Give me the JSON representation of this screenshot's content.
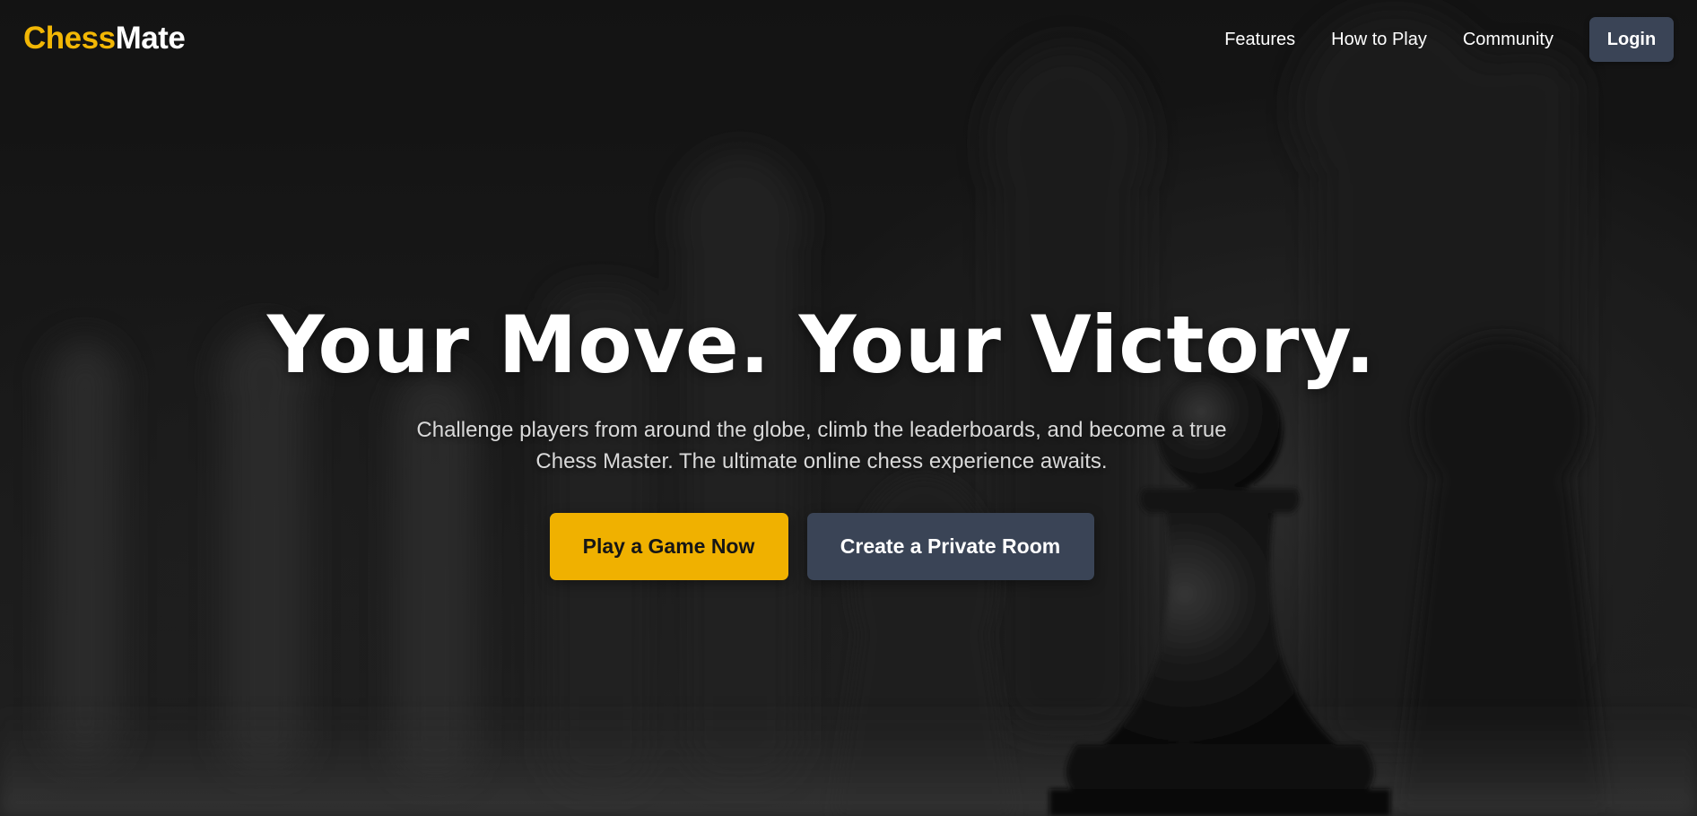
{
  "brand": {
    "part1": "Chess",
    "part2": "Mate",
    "accent_color": "#f2b705"
  },
  "nav": {
    "links": [
      {
        "label": "Features"
      },
      {
        "label": "How to Play"
      },
      {
        "label": "Community"
      }
    ],
    "login_label": "Login"
  },
  "hero": {
    "title": "Your Move. Your Victory.",
    "subtitle": "Challenge players from around the globe, climb the leaderboards, and become a true Chess Master. The ultimate online chess experience awaits.",
    "primary_cta": "Play a Game Now",
    "secondary_cta": "Create a Private Room"
  },
  "colors": {
    "primary_button": "#f0b100",
    "secondary_button": "#3a4456",
    "background": "#161616"
  },
  "background_image": {
    "icon": "chess-pieces-background"
  }
}
